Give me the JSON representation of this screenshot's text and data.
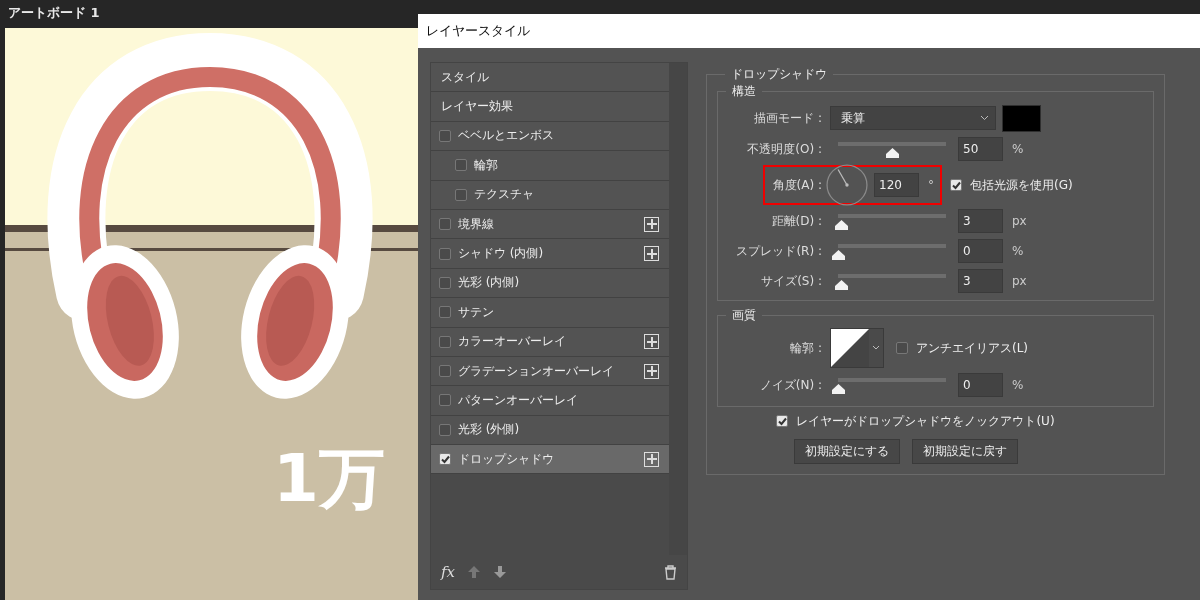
{
  "canvas": {
    "title": "アートボード 1",
    "headline": "1万"
  },
  "dialog": {
    "title": "レイヤースタイル",
    "styles_list": {
      "items": [
        {
          "label": "スタイル",
          "kind": "header",
          "selected": false
        },
        {
          "label": "レイヤー効果",
          "kind": "header",
          "selected": false
        },
        {
          "label": "ベベルとエンボス",
          "kind": "effect",
          "checked": false,
          "selected": false,
          "addable": false,
          "children": [
            {
              "label": "輪郭",
              "kind": "effect",
              "checked": false,
              "selected": false,
              "addable": false
            },
            {
              "label": "テクスチャ",
              "kind": "effect",
              "checked": false,
              "selected": false,
              "addable": false
            }
          ]
        },
        {
          "label": "境界線",
          "kind": "effect",
          "checked": false,
          "selected": false,
          "addable": true
        },
        {
          "label": "シャドウ (内側)",
          "kind": "effect",
          "checked": false,
          "selected": false,
          "addable": true
        },
        {
          "label": "光彩 (内側)",
          "kind": "effect",
          "checked": false,
          "selected": false,
          "addable": false
        },
        {
          "label": "サテン",
          "kind": "effect",
          "checked": false,
          "selected": false,
          "addable": false
        },
        {
          "label": "カラーオーバーレイ",
          "kind": "effect",
          "checked": false,
          "selected": false,
          "addable": true
        },
        {
          "label": "グラデーションオーバーレイ",
          "kind": "effect",
          "checked": false,
          "selected": false,
          "addable": true
        },
        {
          "label": "パターンオーバーレイ",
          "kind": "effect",
          "checked": false,
          "selected": false,
          "addable": false
        },
        {
          "label": "光彩 (外側)",
          "kind": "effect",
          "checked": false,
          "selected": false,
          "addable": false
        },
        {
          "label": "ドロップシャドウ",
          "kind": "effect",
          "checked": true,
          "selected": true,
          "addable": true
        }
      ],
      "footer": {
        "fx_label": "fx"
      }
    },
    "settings": {
      "title": "ドロップシャドウ",
      "structure": {
        "title": "構造",
        "rows": [
          {
            "kind": "select",
            "label": "描画モード :",
            "value": "乗算",
            "color": "#000000"
          },
          {
            "kind": "slider",
            "label": "不透明度(O) :",
            "level": 0.5,
            "value": "50",
            "unit": "%"
          },
          {
            "kind": "angle",
            "label": "角度(A) :",
            "value": "120",
            "unit": "°",
            "global_light": {
              "label": "包括光源を使用(G)",
              "checked": true
            }
          },
          {
            "kind": "slider",
            "label": "距離(D) :",
            "level": 0.03,
            "value": "3",
            "unit": "px"
          },
          {
            "kind": "slider",
            "label": "スプレッド(R) :",
            "level": 0,
            "value": "0",
            "unit": "%"
          },
          {
            "kind": "slider",
            "label": "サイズ(S) :",
            "level": 0.03,
            "value": "3",
            "unit": "px"
          }
        ]
      },
      "quality": {
        "title": "画質",
        "rows": [
          {
            "kind": "contour",
            "label": "輪郭 :",
            "anti_alias": {
              "label": "アンチエイリアス(L)",
              "checked": false
            }
          },
          {
            "kind": "slider",
            "label": "ノイズ(N) :",
            "level": 0,
            "value": "0",
            "unit": "%"
          }
        ]
      },
      "knockout": {
        "label": "レイヤーがドロップシャドウをノックアウト(U)",
        "checked": true
      },
      "buttons": [
        "初期設定にする",
        "初期設定に戻す"
      ]
    }
  }
}
